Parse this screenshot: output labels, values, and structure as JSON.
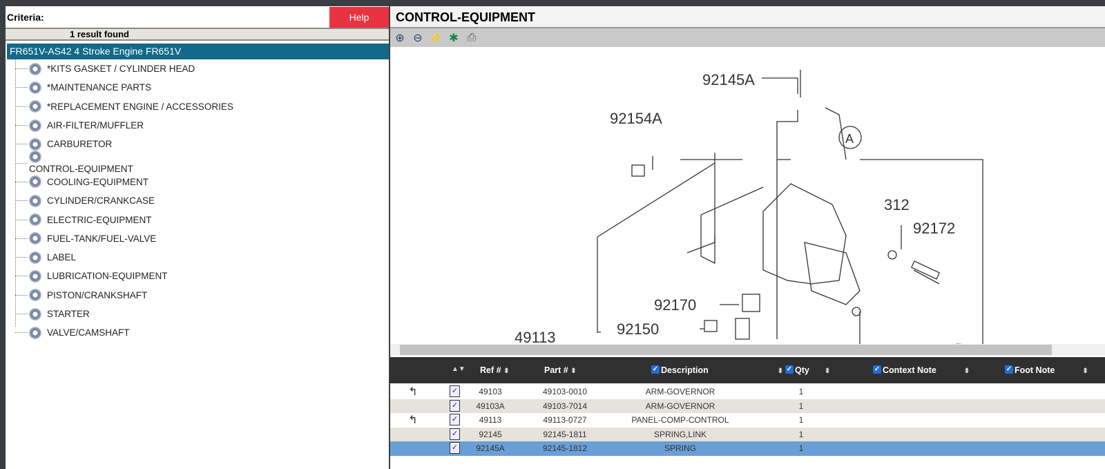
{
  "left": {
    "criteria_label": "Criteria:",
    "help_label": "Help",
    "result_text": "1 result found",
    "root": "FR651V-AS42 4 Stroke Engine FR651V",
    "items": [
      "*KITS GASKET / CYLINDER HEAD",
      "*MAINTENANCE PARTS",
      "*REPLACEMENT ENGINE / ACCESSORIES",
      "AIR-FILTER/MUFFLER",
      "CARBURETOR",
      "CONTROL-EQUIPMENT",
      "COOLING-EQUIPMENT",
      "CYLINDER/CRANKCASE",
      "ELECTRIC-EQUIPMENT",
      "FUEL-TANK/FUEL-VALVE",
      "LABEL",
      "LUBRICATION-EQUIPMENT",
      "PISTON/CRANKSHAFT",
      "STARTER",
      "VALVE/CAMSHAFT"
    ],
    "selected": "CONTROL-EQUIPMENT"
  },
  "right": {
    "title": "CONTROL-EQUIPMENT",
    "toolbar": [
      "zoom-in-icon",
      "zoom-out-icon",
      "lightning-icon",
      "bug-icon",
      "printer-icon"
    ],
    "diagram_labels": {
      "a": "92145A",
      "b": "92154A",
      "c": "A",
      "d": "312",
      "e": "92172",
      "f": "92170",
      "g": "92150",
      "h": "49113"
    }
  },
  "table": {
    "headers": {
      "ref": "Ref #",
      "part": "Part #",
      "desc": "Description",
      "qty": "Qty",
      "context": "Context Note",
      "foot": "Foot Note"
    },
    "rows": [
      {
        "ref": "49103",
        "part": "49103-0010",
        "desc": "ARM-GOVERNOR",
        "qty": "1",
        "arrow": true
      },
      {
        "ref": "49103A",
        "part": "49103-7014",
        "desc": "ARM-GOVERNOR",
        "qty": "1",
        "arrow": false
      },
      {
        "ref": "49113",
        "part": "49113-0727",
        "desc": "PANEL-COMP-CONTROL",
        "qty": "1",
        "arrow": true
      },
      {
        "ref": "92145",
        "part": "92145-1811",
        "desc": "SPRING,LINK",
        "qty": "1",
        "arrow": false
      },
      {
        "ref": "92145A",
        "part": "92145-1812",
        "desc": "SPRING",
        "qty": "1",
        "arrow": false,
        "selected": true
      }
    ]
  },
  "colors": {
    "help": "#e8323f",
    "root": "#13698a",
    "selected_row": "#6a9fd6",
    "header": "#303030"
  }
}
